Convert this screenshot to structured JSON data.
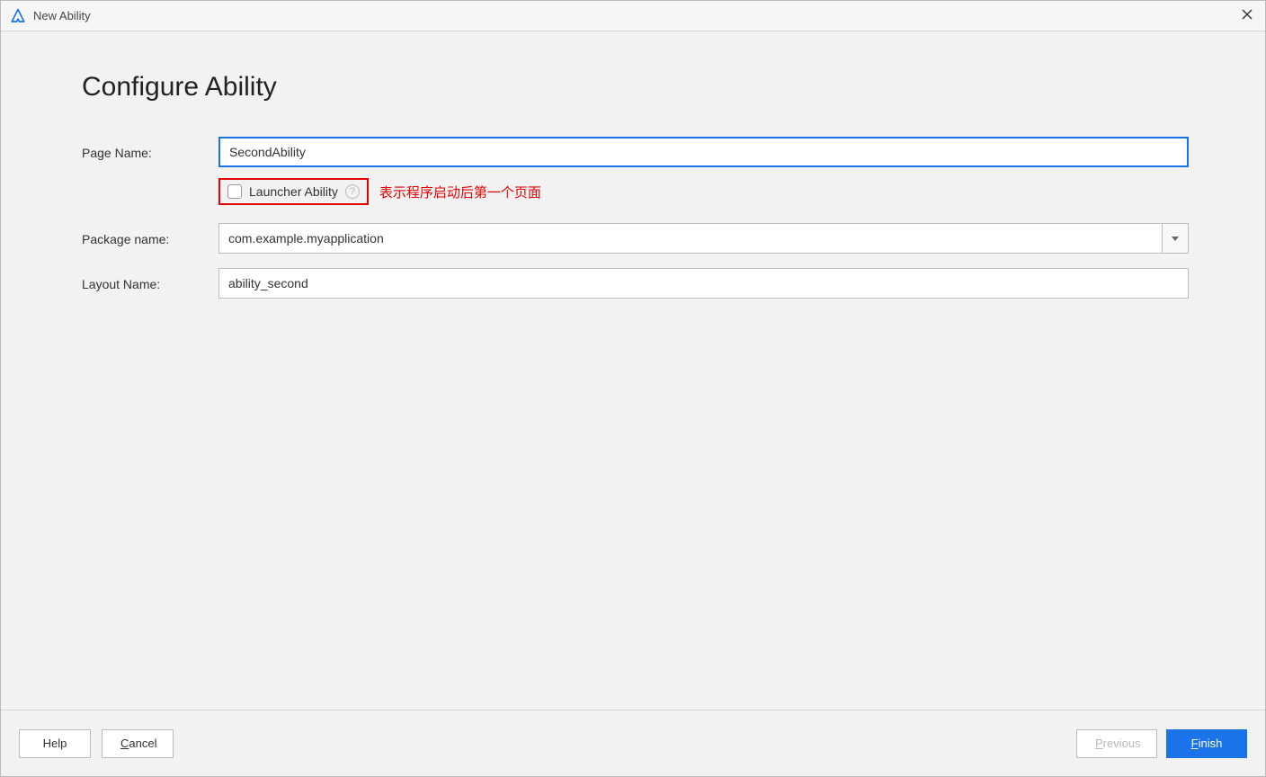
{
  "titlebar": {
    "title": "New Ability"
  },
  "heading": "Configure Ability",
  "form": {
    "page_name": {
      "label": "Page Name:",
      "value": "SecondAbility"
    },
    "launcher": {
      "label": "Launcher Ability",
      "annotation": "表示程序启动后第一个页面",
      "checked": false
    },
    "package_name": {
      "label": "Package name:",
      "value": "com.example.myapplication"
    },
    "layout_name": {
      "label": "Layout Name:",
      "value": "ability_second"
    }
  },
  "footer": {
    "help": "Help",
    "cancel_prefix": "C",
    "cancel_rest": "ancel",
    "previous_prefix": "P",
    "previous_rest": "revious",
    "finish_prefix": "F",
    "finish_rest": "inish"
  }
}
